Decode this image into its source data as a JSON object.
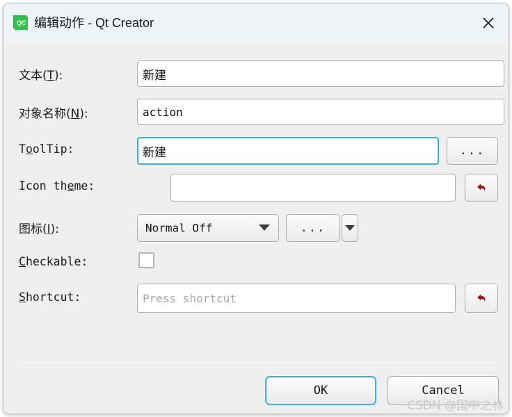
{
  "window": {
    "title": "编辑动作 - Qt Creator",
    "app_icon_label": "QC",
    "app_icon_color": "#30c14f",
    "titlebar_color": "#eef4f5",
    "close_icon": "close-icon"
  },
  "form": {
    "rows": [
      {
        "label_prefix": "文本(",
        "mnemonic": "T",
        "label_suffix": "):",
        "value": "新建"
      },
      {
        "label_prefix": "对象名称(",
        "mnemonic": "N",
        "label_suffix": "):",
        "value": "action"
      },
      {
        "label_prefix": "T",
        "mnemonic": "o",
        "label_suffix": "olTip:",
        "value": "新建",
        "browse_label": "..."
      },
      {
        "label_prefix": "Icon th",
        "mnemonic": "e",
        "label_suffix": "me:",
        "value": "",
        "reset_icon": "reset-arrow-icon"
      },
      {
        "label_prefix": "图标(",
        "mnemonic": "I",
        "label_suffix": "):",
        "selected_option": "Normal Off",
        "options": [
          "Normal Off"
        ],
        "browse_label": "...",
        "dropdown_icon": "chevron-down-icon"
      },
      {
        "label_prefix": "",
        "mnemonic": "C",
        "label_suffix": "heckable:",
        "checked": false
      },
      {
        "label_prefix": "",
        "mnemonic": "S",
        "label_suffix": "hortcut:",
        "value": "",
        "placeholder": "Press shortcut",
        "reset_icon": "reset-arrow-icon"
      }
    ]
  },
  "footer": {
    "ok_label": "OK",
    "cancel_label": "Cancel",
    "accent_color": "#3daee9"
  },
  "watermark": {
    "text": "CSDN @国中之林"
  }
}
